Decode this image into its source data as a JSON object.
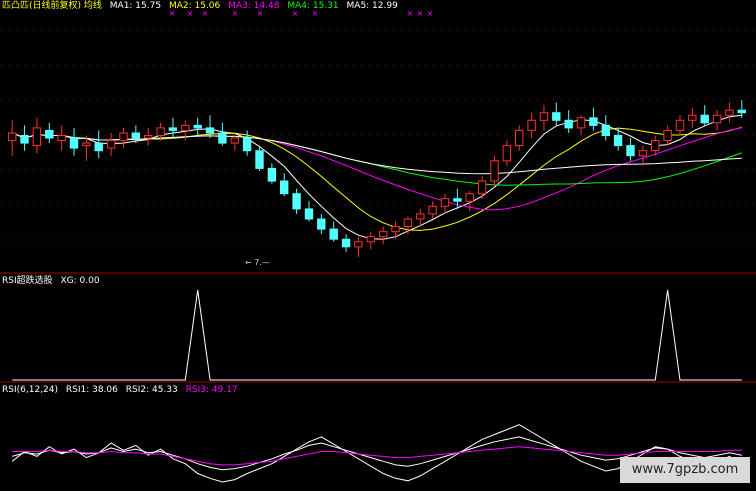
{
  "panels": {
    "price": {
      "title": "匹凸匹(日线前复权) 均线",
      "ma": [
        {
          "label": "MA1: 15.75",
          "color": "#ffffff"
        },
        {
          "label": "MA2: 15.06",
          "color": "#ffff00"
        },
        {
          "label": "MA3: 14.48",
          "color": "#ff00ff"
        },
        {
          "label": "MA4: 15.31",
          "color": "#00ff00"
        },
        {
          "label": "MA5: 12.99",
          "color": "#ffffff"
        }
      ],
      "marker_text": "×",
      "low_label": "← 7.—"
    },
    "xg": {
      "title": "RSI超跌选股",
      "value": "XG: 0.00"
    },
    "rsi": {
      "title": "RSI(6,12,24)",
      "items": [
        {
          "label": "RSI1: 38.06",
          "color": "#ffffff"
        },
        {
          "label": "RSI2: 45.33",
          "color": "#ffffff"
        },
        {
          "label": "RSI3: 49.17",
          "color": "#ff00ff"
        }
      ]
    }
  },
  "watermark": "www.7gpzb.com",
  "colors": {
    "up": "#ff3030",
    "down": "#54ffff",
    "separator": "#a00000"
  },
  "chart_data": [
    {
      "type": "candlestick",
      "title": "匹凸匹(日线前复权)",
      "candles": [
        [
          0,
          15.0,
          15.8,
          14.4,
          15.3
        ],
        [
          1,
          15.2,
          15.6,
          14.6,
          14.9
        ],
        [
          2,
          14.8,
          15.9,
          14.5,
          15.5
        ],
        [
          3,
          15.4,
          15.7,
          14.9,
          15.1
        ],
        [
          4,
          15.0,
          15.6,
          14.6,
          15.2
        ],
        [
          5,
          15.1,
          15.5,
          14.4,
          14.7
        ],
        [
          6,
          14.8,
          15.2,
          14.2,
          14.9
        ],
        [
          7,
          14.9,
          15.4,
          14.3,
          14.6
        ],
        [
          8,
          14.7,
          15.3,
          14.4,
          15.0
        ],
        [
          9,
          15.0,
          15.5,
          14.7,
          15.3
        ],
        [
          10,
          15.3,
          15.6,
          14.9,
          15.1
        ],
        [
          11,
          15.1,
          15.5,
          14.8,
          15.2
        ],
        [
          12,
          15.2,
          15.7,
          15.0,
          15.5
        ],
        [
          13,
          15.5,
          15.9,
          15.1,
          15.4
        ],
        [
          14,
          15.4,
          15.8,
          15.0,
          15.6
        ],
        [
          15,
          15.6,
          15.9,
          15.2,
          15.5
        ],
        [
          16,
          15.5,
          16.0,
          15.1,
          15.3
        ],
        [
          17,
          15.3,
          15.7,
          14.8,
          14.9
        ],
        [
          18,
          14.9,
          15.2,
          14.6,
          15.1
        ],
        [
          19,
          15.1,
          15.4,
          14.4,
          14.6
        ],
        [
          20,
          14.6,
          14.8,
          13.8,
          13.9
        ],
        [
          21,
          13.9,
          14.1,
          13.3,
          13.4
        ],
        [
          22,
          13.4,
          13.7,
          12.8,
          12.9
        ],
        [
          23,
          12.9,
          13.1,
          12.1,
          12.3
        ],
        [
          24,
          12.3,
          12.6,
          11.8,
          11.9
        ],
        [
          25,
          11.9,
          12.1,
          11.3,
          11.5
        ],
        [
          26,
          11.5,
          11.8,
          11.0,
          11.1
        ],
        [
          27,
          11.1,
          11.3,
          10.6,
          10.8
        ],
        [
          28,
          10.8,
          11.2,
          10.4,
          11.0
        ],
        [
          29,
          11.0,
          11.4,
          10.7,
          11.2
        ],
        [
          30,
          11.2,
          11.6,
          10.9,
          11.4
        ],
        [
          31,
          11.4,
          11.8,
          11.1,
          11.6
        ],
        [
          32,
          11.6,
          12.0,
          11.3,
          11.9
        ],
        [
          33,
          11.9,
          12.3,
          11.6,
          12.1
        ],
        [
          34,
          12.1,
          12.6,
          11.9,
          12.4
        ],
        [
          35,
          12.4,
          12.9,
          12.1,
          12.7
        ],
        [
          36,
          12.7,
          13.1,
          12.3,
          12.6
        ],
        [
          37,
          12.6,
          13.0,
          12.2,
          12.9
        ],
        [
          38,
          12.9,
          13.6,
          12.7,
          13.4
        ],
        [
          39,
          13.4,
          14.4,
          13.2,
          14.2
        ],
        [
          40,
          14.2,
          15.0,
          14.0,
          14.8
        ],
        [
          41,
          14.8,
          15.6,
          14.6,
          15.4
        ],
        [
          42,
          15.4,
          16.1,
          15.1,
          15.8
        ],
        [
          43,
          15.8,
          16.4,
          15.4,
          16.1
        ],
        [
          44,
          16.1,
          16.5,
          15.6,
          15.8
        ],
        [
          45,
          15.8,
          16.2,
          15.3,
          15.5
        ],
        [
          46,
          15.5,
          16.0,
          15.2,
          15.9
        ],
        [
          47,
          15.9,
          16.3,
          15.4,
          15.6
        ],
        [
          48,
          15.6,
          16.0,
          15.0,
          15.2
        ],
        [
          49,
          15.2,
          15.5,
          14.6,
          14.8
        ],
        [
          50,
          14.8,
          15.1,
          14.2,
          14.4
        ],
        [
          51,
          14.4,
          14.8,
          14.0,
          14.6
        ],
        [
          52,
          14.6,
          15.2,
          14.4,
          15.0
        ],
        [
          53,
          15.0,
          15.6,
          14.8,
          15.4
        ],
        [
          54,
          15.4,
          16.0,
          15.2,
          15.8
        ],
        [
          55,
          15.8,
          16.3,
          15.5,
          16.0
        ],
        [
          56,
          16.0,
          16.4,
          15.6,
          15.7
        ],
        [
          57,
          15.7,
          16.2,
          15.4,
          16.0
        ],
        [
          58,
          16.0,
          16.5,
          15.7,
          16.2
        ],
        [
          59,
          16.2,
          16.6,
          15.9,
          16.1
        ]
      ]
    },
    {
      "type": "line",
      "title": "RSI超跌选股",
      "series": [
        {
          "name": "XG",
          "points": [
            [
              0,
              0
            ],
            [
              14,
              0
            ],
            [
              15,
              1
            ],
            [
              16,
              0
            ],
            [
              52,
              0
            ],
            [
              53,
              1
            ],
            [
              54,
              0
            ],
            [
              59,
              0
            ]
          ]
        }
      ],
      "ylim": [
        0,
        1
      ]
    },
    {
      "type": "line",
      "title": "RSI(6,12,24)",
      "series": [
        {
          "name": "RSI1",
          "values": [
            40,
            48,
            44,
            52,
            46,
            50,
            43,
            47,
            55,
            49,
            53,
            45,
            50,
            42,
            38,
            30,
            26,
            22,
            25,
            30,
            34,
            38,
            44,
            50,
            56,
            60,
            54,
            48,
            42,
            36,
            30,
            26,
            24,
            28,
            34,
            40,
            46,
            52,
            58,
            62,
            66,
            70,
            64,
            58,
            52,
            46,
            40,
            36,
            32,
            34,
            40,
            46,
            52,
            50,
            44,
            40,
            36,
            40,
            44,
            38
          ]
        },
        {
          "name": "RSI2",
          "values": [
            44,
            47,
            46,
            49,
            47,
            48,
            46,
            47,
            51,
            48,
            50,
            47,
            48,
            45,
            42,
            38,
            35,
            33,
            34,
            36,
            39,
            42,
            46,
            49,
            53,
            55,
            52,
            49,
            46,
            43,
            40,
            37,
            36,
            38,
            41,
            44,
            47,
            50,
            53,
            56,
            58,
            60,
            57,
            54,
            51,
            48,
            45,
            43,
            41,
            42,
            45,
            48,
            51,
            50,
            47,
            45,
            43,
            45,
            47,
            45
          ]
        },
        {
          "name": "RSI3",
          "values": [
            48,
            48,
            48,
            49,
            48,
            48,
            47,
            47,
            48,
            47,
            47,
            46,
            46,
            44,
            42,
            40,
            38,
            37,
            37,
            38,
            39,
            40,
            42,
            44,
            46,
            48,
            48,
            47,
            46,
            45,
            44,
            43,
            43,
            44,
            45,
            46,
            47,
            48,
            49,
            50,
            51,
            52,
            51,
            50,
            49,
            48,
            47,
            46,
            45,
            45,
            46,
            47,
            48,
            48,
            48,
            48,
            48,
            48,
            49,
            49
          ]
        }
      ],
      "ylim": [
        0,
        100
      ]
    }
  ]
}
